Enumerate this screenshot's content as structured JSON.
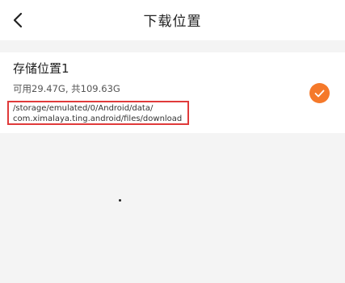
{
  "header": {
    "title": "下载位置",
    "back_icon": "chevron-left-icon"
  },
  "storage": {
    "name": "存储位置1",
    "capacity": "可用29.47G, 共109.63G",
    "path_line1": "/storage/emulated/0/Android/data/",
    "path_line2": "com.ximalaya.ting.android/files/download",
    "selected": true,
    "check_icon": "check-icon"
  },
  "colors": {
    "accent": "#f5792a",
    "highlight_border": "#e03a3a",
    "background": "#f4f4f4",
    "card": "#ffffff"
  }
}
